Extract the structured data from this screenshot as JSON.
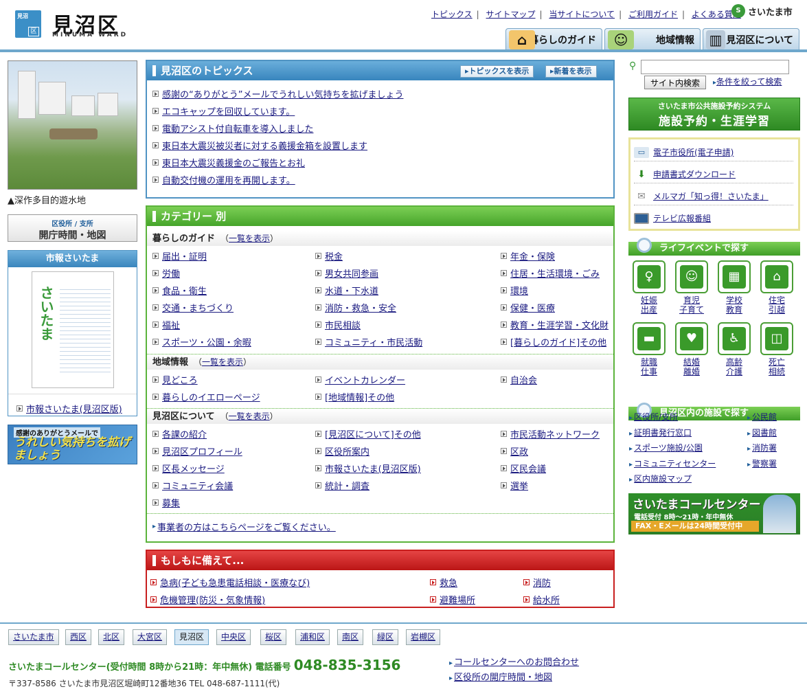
{
  "header": {
    "logo_top": "見沼",
    "logo_bottom": "区",
    "ward_name": "見沼区",
    "ward_sub": "MINUMA WARD",
    "top_links": [
      "トピックス",
      "サイトマップ",
      "当サイトについて",
      "ご利用ガイド",
      "よくある質問"
    ],
    "city_logo": "さいたま市",
    "nav": [
      "暮らしのガイド",
      "地域情報",
      "見沼区について"
    ]
  },
  "left": {
    "photo_caption": "▲深作多目的遊水地",
    "office_small": "区役所 / 支所",
    "office_main": "開庁時間・地図",
    "shiho_title": "市報さいたま",
    "shiho_cover_text": "さいたま",
    "shiho_link": "市報さいたま(見沼区版)",
    "banner_small": "感謝のありがとうメールで",
    "banner_main": "うれしい気持ちを拡げましょう"
  },
  "topics": {
    "title": "見沼区のトピックス",
    "btn_show": "トピックスを表示",
    "btn_new": "新着を表示",
    "items": [
      "感謝の“ありがとう”メールでうれしい気持ちを拡げましょう",
      "エコキャップを回収しています。",
      "電動アシスト付自転車を導入しました",
      "東日本大震災被災者に対する義援金箱を設置します",
      "東日本大震災義援金のご報告とお礼",
      "自動交付機の運用を再開します。"
    ]
  },
  "category": {
    "title": "カテゴリー 別",
    "list_link": "一覧を表示",
    "s1": {
      "title": "暮らしのガイド",
      "items": [
        "届出・証明",
        "税金",
        "年金・保険",
        "労働",
        "男女共同参画",
        "住居・生活環境・ごみ",
        "食品・衛生",
        "水道・下水道",
        "環境",
        "交通・まちづくり",
        "消防・救急・安全",
        "保健・医療",
        "福祉",
        "市民相談",
        "教育・生涯学習・文化財",
        "スポーツ・公園・余暇",
        "コミュニティ・市民活動",
        "[暮らしのガイド]その他"
      ]
    },
    "s2": {
      "title": "地域情報",
      "items": [
        "見どころ",
        "イベントカレンダー",
        "自治会",
        "暮らしのイエローページ",
        "[地域情報]その他"
      ]
    },
    "s3": {
      "title": "見沼区について",
      "items": [
        "各課の紹介",
        "[見沼区について]その他",
        "市民活動ネットワーク",
        "見沼区プロフィール",
        "区役所案内",
        "区政",
        "区長メッセージ",
        "市報さいたま(見沼区版)",
        "区民会議",
        "コミュニティ会議",
        "統計・調査",
        "選挙",
        "募集"
      ]
    },
    "jigyosha": "事業者の方はこちらページをご覧ください。"
  },
  "moshi": {
    "title": "もしもに備えて...",
    "items": [
      "急病(子ども急患電話相談・医療なび)",
      "救急",
      "消防",
      "危機管理(防災・気象情報)",
      "避難場所",
      "給水所"
    ]
  },
  "right": {
    "search_button": "サイト内検索",
    "search_cond": "条件を絞って検索",
    "shisetsu_small": "さいたま市公共施設予約システム",
    "shisetsu_main": "施設予約・生涯学習",
    "eservices": [
      "電子市役所(電子申請)",
      "申請書式ダウンロード",
      "メルマガ「知っ得！さいたま」",
      "テレビ広報番組"
    ],
    "life_title": "ライフイベントで探す",
    "life": [
      [
        "妊娠",
        "出産"
      ],
      [
        "育児",
        "子育て"
      ],
      [
        "学校",
        "教育"
      ],
      [
        "住宅",
        "引越"
      ],
      [
        "就職",
        "仕事"
      ],
      [
        "結婚",
        "離婚"
      ],
      [
        "高齢",
        "介護"
      ],
      [
        "死亡",
        "相続"
      ]
    ],
    "fac_title": "見沼区内の施設で探す",
    "facilities": [
      "区役所/支所",
      "公民館",
      "証明書発行窓口",
      "図書館",
      "スポーツ施設/公園",
      "消防署",
      "コミュニティセンター",
      "警察署",
      "区内施設マップ"
    ],
    "call_title": "さいたまコールセンター",
    "call_hours": "電話受付 8時～21時・年中無休",
    "call_fax": "FAX・Eメールは24時間受付中"
  },
  "footer": {
    "wards": [
      "さいたま市",
      "西区",
      "北区",
      "大宮区",
      "見沼区",
      "中央区",
      "桜区",
      "浦和区",
      "南区",
      "緑区",
      "岩槻区"
    ],
    "call_text": "さいたまコールセンター(受付時間 8時から21時：年中無休) 電話番号",
    "call_number": "048-835-3156",
    "address": "〒337-8586 さいたま市見沼区堀崎町12番地36 TEL 048-687-1111(代)",
    "links": [
      "コールセンターへのお問合わせ",
      "区役所の開庁時間・地図"
    ]
  }
}
